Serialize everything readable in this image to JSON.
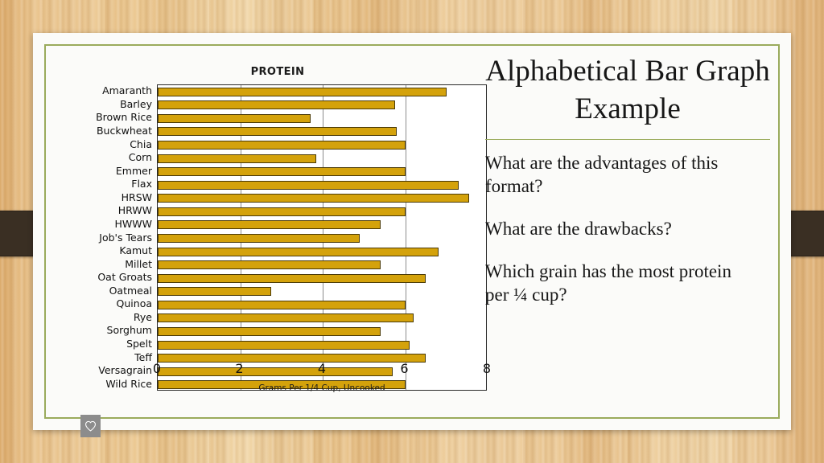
{
  "slide": {
    "title": "Alphabetical Bar Graph Example",
    "questions": [
      "What are the advantages of this format?",
      "What are the drawbacks?",
      "Which grain has the most protein per ¼ cup?"
    ],
    "watermark_icon": "heart-icon",
    "accent_color": "#9aab5c",
    "bar_color": "#d4a20b",
    "background": "wood-texture"
  },
  "chart_data": {
    "type": "bar",
    "orientation": "horizontal",
    "title": "PROTEIN",
    "xlabel": "Grams Per 1/4 Cup, Uncooked",
    "ylabel": "",
    "xlim": [
      0,
      8
    ],
    "xticks": [
      0,
      2,
      4,
      6,
      8
    ],
    "grid": true,
    "legend": false,
    "categories": [
      "Amaranth",
      "Barley",
      "Brown Rice",
      "Buckwheat",
      "Chia",
      "Corn",
      "Emmer",
      "Flax",
      "HRSW",
      "HRWW",
      "HWWW",
      "Job's Tears",
      "Kamut",
      "Millet",
      "Oat Groats",
      "Oatmeal",
      "Quinoa",
      "Rye",
      "Sorghum",
      "Spelt",
      "Teff",
      "Versagrain",
      "Wild Rice"
    ],
    "values": [
      7.0,
      5.75,
      3.7,
      5.8,
      6.0,
      3.85,
      6.0,
      7.3,
      7.55,
      6.0,
      5.4,
      4.9,
      6.8,
      5.4,
      6.5,
      2.75,
      6.0,
      6.2,
      5.4,
      6.1,
      6.5,
      5.7,
      6.0
    ]
  }
}
